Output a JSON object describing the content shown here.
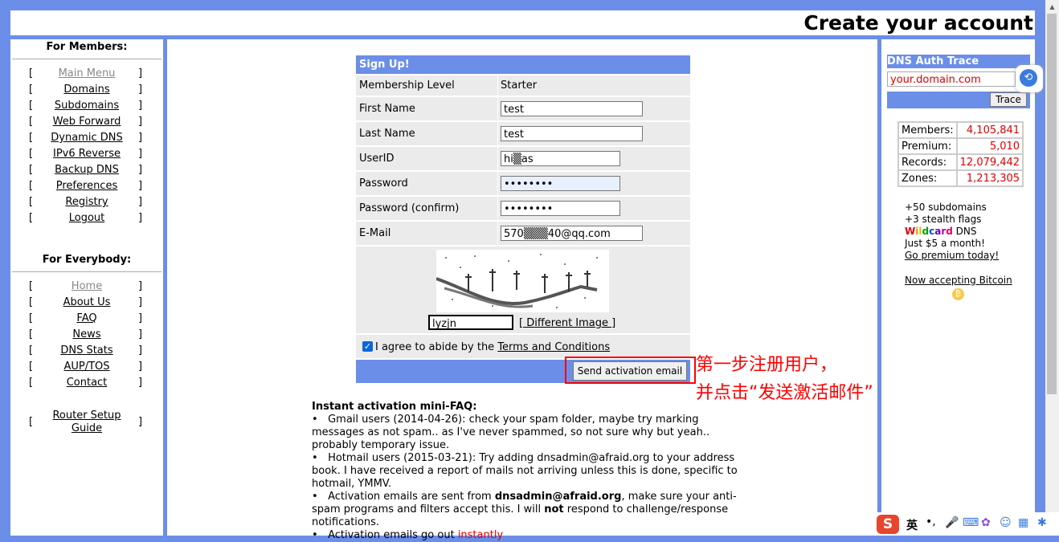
{
  "header": {
    "title": "Create your account"
  },
  "left": {
    "members_title": "For Members:",
    "members": [
      {
        "label": "Main Menu",
        "current": true
      },
      {
        "label": "Domains"
      },
      {
        "label": "Subdomains"
      },
      {
        "label": "Web Forward"
      },
      {
        "label": "Dynamic DNS"
      },
      {
        "label": "IPv6 Reverse"
      },
      {
        "label": "Backup DNS"
      },
      {
        "label": "Preferences"
      },
      {
        "label": "Registry"
      },
      {
        "label": "Logout"
      }
    ],
    "everybody_title": "For Everybody:",
    "everybody": [
      {
        "label": "Home",
        "current": true
      },
      {
        "label": "About Us"
      },
      {
        "label": "FAQ"
      },
      {
        "label": "News"
      },
      {
        "label": "DNS Stats"
      },
      {
        "label": "AUP/TOS"
      },
      {
        "label": "Contact"
      }
    ],
    "router_line1": "Router Setup",
    "router_line2": "Guide",
    "bracket_open": "[",
    "bracket_close": "]"
  },
  "form": {
    "title": "Sign Up!",
    "membership_label": "Membership Level",
    "membership_value": "Starter",
    "first_name_label": "First Name",
    "first_name_value": "test",
    "last_name_label": "Last Name",
    "last_name_value": "test",
    "userid_label": "UserID",
    "userid_value": "hi▒as",
    "password_label": "Password",
    "password_value": "••••••••",
    "password_confirm_label": "Password (confirm)",
    "password_confirm_value": "••••••••",
    "email_label": "E-Mail",
    "email_value": "570▒▒▒40@qq.com",
    "captcha_value": "lyzjn",
    "different_image": "[ Different Image ]",
    "agree_prefix": "I agree to abide by the ",
    "agree_link": "Terms and Conditions",
    "submit_label": "Send activation email"
  },
  "faq": {
    "title": "Instant activation mini-FAQ:",
    "items": [
      "Gmail users (2014-04-26): check your spam folder, maybe try marking messages as not spam.. as I've never spammed, so not sure why but yeah.. probably temporary issue.",
      "Hotmail users (2015-03-21): Try adding dnsadmin@afraid.org to your address book. I have received a report of mails not arriving unless this is done, specific to hotmail, YMMV.",
      "Activation emails are sent from dnsadmin@afraid.org, make sure your anti-spam programs and filters accept this. I will not respond to challenge/response notifications.",
      "Activation emails go out instantly."
    ],
    "bullet": "•",
    "item3_a": "Activation emails are sent from ",
    "item3_bold": "dnsadmin@afraid.org",
    "item3_b": ", make sure your anti-spam programs and filters accept this. I will ",
    "item3_not": "not",
    "item3_c": " respond to challenge/response notifications.",
    "item4_a": "Activation emails go out ",
    "item4_red": "instantly"
  },
  "annotation": {
    "line1": "第一步注册用户，",
    "line2": "并点击“发送激活邮件”"
  },
  "right": {
    "trace_title": "DNS Auth Trace",
    "trace_placeholder": "your.domain.com",
    "trace_button": "Trace",
    "stats": [
      {
        "label": "Members:",
        "value": "4,105,841"
      },
      {
        "label": "Premium:",
        "value": "5,010"
      },
      {
        "label": "Records:",
        "value": "12,079,442"
      },
      {
        "label": "Zones:",
        "value": "1,213,305"
      }
    ],
    "promo1": "+50 subdomains",
    "promo2": "+3 stealth flags",
    "promo3_word": "Wildcard",
    "promo3_rest": " DNS",
    "promo4": "Just $5 a month!",
    "promo5": "Go premium today!",
    "bitcoin": "Now accepting Bitcoin"
  },
  "ime": {
    "label": "英"
  },
  "colors": {
    "accent": "#6b8ee8",
    "red": "#ff0000",
    "stat_value": "#e00000"
  }
}
